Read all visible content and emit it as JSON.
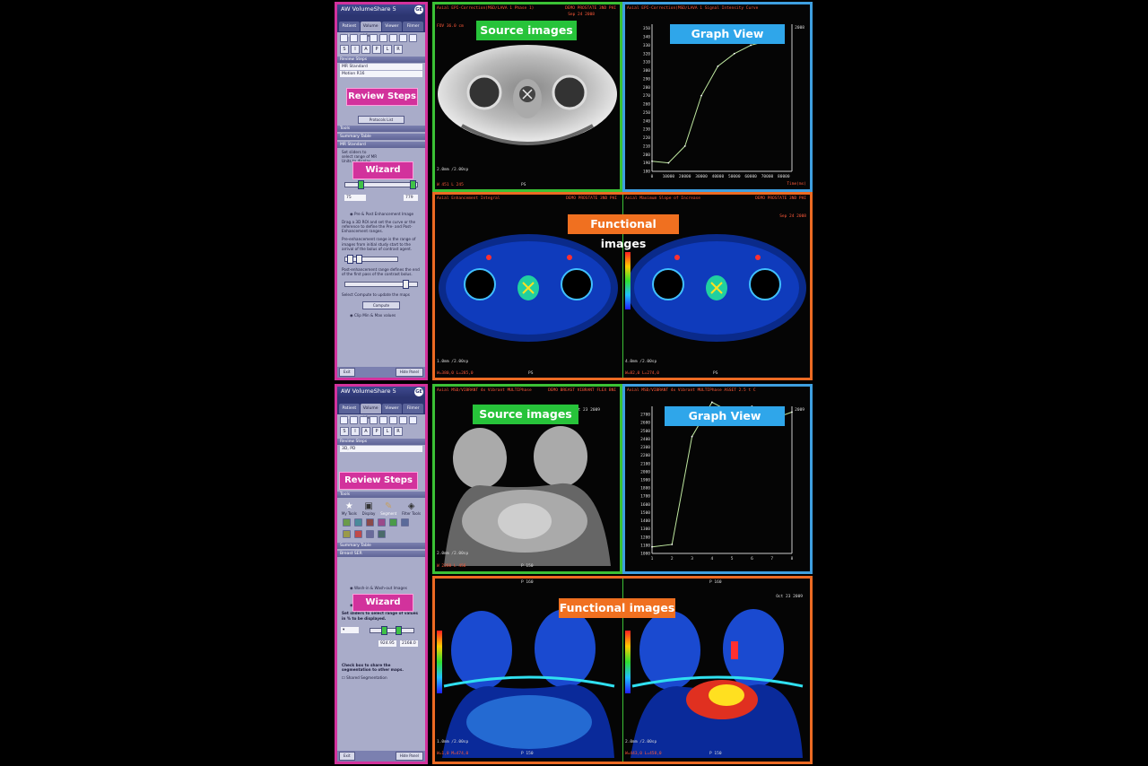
{
  "top": {
    "sidebar": {
      "app_title": "AW VolumeShare 5",
      "tabs": [
        "Patient List",
        "Volume Viewer",
        "Viewer",
        "Filmer"
      ],
      "letters": [
        "S",
        "I",
        "A",
        "P",
        "L",
        "R"
      ],
      "review_steps_bar": "Review Steps",
      "field1": "MR Standard",
      "field2": "Motion R16",
      "review_steps_tag": "Review Steps",
      "protocols_list": "Protocols List",
      "tools_bar": "Tools",
      "summary_table_bar": "Summary Table",
      "mr_standard_bar": "MR Standard",
      "wizard_tag": "Wizard",
      "set_sliders_text": "Set sliders to select range of MR Units to display",
      "min_value": "75",
      "max_value": "779",
      "pre_post_option": "Pre & Post Enhancement Image",
      "instruction1": "Drag a 3D ROI and set the curve or the reference to define the Pre- and Post-Enhancement ranges.",
      "instruction2": "Pre-enhancement range is the range of images from initial study start to the arrival of the bolus of contrast agent.",
      "instruction3": "Post-enhancement range defines the end of the first pass of the contrast bolus.",
      "compute_hint": "Select Compute to update the maps",
      "compute_button": "Compute",
      "clip_option": "Clip Min & Max values",
      "exit_button": "Exit",
      "hide_panel_button": "Hide Panel"
    },
    "source_label": "Source images",
    "graph_label": "Graph View",
    "functional_label": "Functional images",
    "source_overlay": {
      "header": "Axial EPI-Correction(MSD/LAVA 1 Phase 1)",
      "patient": "DEMO PROSTATE 3ND PHI",
      "date": "Sep 24 2008",
      "fov": "FOV 36.0 cm",
      "bottom": "2.0mm /2.00sp",
      "wl": "W 451 L 245",
      "ps": "PS"
    },
    "graph_overlay": {
      "header": "Axial EPI-Correction(MSD/LAVA 1 Signal Intensity Curve",
      "date": "2008",
      "xlabel": "Time(ms)",
      "y_ticks": [
        "350",
        "340",
        "330",
        "320",
        "310",
        "300",
        "290",
        "280",
        "270",
        "260",
        "250",
        "240",
        "230",
        "220",
        "210",
        "200",
        "190",
        "180"
      ],
      "x_ticks": [
        "0",
        "10000",
        "20000",
        "30000",
        "40000",
        "50000",
        "60000",
        "70000",
        "80000"
      ]
    },
    "func_left_overlay": {
      "header": "Axial Enhancement Integral",
      "patient": "DEMO PROSTATE 3ND PHI",
      "bottom": "1.0mm /2.00sp",
      "wl": "W=380,0 L=285,0",
      "ps": "PS"
    },
    "func_right_overlay": {
      "header": "Axial Maximum Slope of Increase",
      "patient": "DEMO PROSTATE 3ND PHI",
      "date": "Sep 24 2008",
      "bottom": "4.0mm /2.00sp",
      "wl": "W=82,0 L=274,0",
      "ps": "PS"
    },
    "chart_data": {
      "type": "line",
      "x": [
        0,
        10000,
        20000,
        30000,
        40000,
        50000,
        60000,
        70000,
        80000
      ],
      "y": [
        192,
        190,
        210,
        270,
        305,
        320,
        330,
        335,
        338
      ],
      "xlabel": "Time(ms)",
      "ylim": [
        180,
        355
      ]
    }
  },
  "bottom": {
    "sidebar": {
      "app_title": "AW VolumeShare 5",
      "tabs": [
        "Patient List",
        "Volume Viewer",
        "Viewer",
        "Filmer"
      ],
      "letters": [
        "S",
        "I",
        "A",
        "P",
        "L",
        "R"
      ],
      "review_steps_bar": "Review Steps",
      "field1": "3D, PD",
      "review_steps_tag": "Review Steps",
      "protocols_list": "Protocols List",
      "tools_bar": "Tools",
      "tools_labels": [
        "My Tools",
        "Display",
        "Segment",
        "Filter Tools"
      ],
      "summary_table_bar": "Summary Table",
      "breast_ser_bar": "Breast SER",
      "wizard_tag": "Wizard",
      "wash_option": "Wash-in & Wash-out Images",
      "clip_option": "Clip Min & Max values",
      "set_sliders_text": "Set sliders to select range of values in % to be displayed.",
      "min_value": "924.95",
      "max_value": "2168.0",
      "share_text": "Check box to share the segmentation to other maps.",
      "shared_seg": "Shared Segmentation",
      "exit_button": "Exit",
      "hide_panel_button": "Hide Panel"
    },
    "source_label": "Source images",
    "graph_label": "Graph View",
    "functional_label": "Functional images",
    "source_overlay": {
      "header": "Axial MSD/VIBRANT 4x Vibrant MULTIPhase",
      "patient": "DEMO BREAST VIBRANT FLEX BNI",
      "date": "Oct 23 2009",
      "bottom": "2.0mm /2.00sp",
      "wl": "W 2260 L 456",
      "ps": "P 150"
    },
    "graph_overlay": {
      "header": "Axial MSD/VIBRANT 4x Vibrant MULTIPhase ASSET 2.5 t C",
      "date": "2009",
      "y_ticks": [
        "2700",
        "2600",
        "2500",
        "2400",
        "2300",
        "2200",
        "2100",
        "2000",
        "1900",
        "1800",
        "1700",
        "1600",
        "1500",
        "1400",
        "1300",
        "1200",
        "1100",
        "1000"
      ],
      "x_ticks": [
        "1",
        "2",
        "3",
        "4",
        "5",
        "6",
        "7",
        "8"
      ]
    },
    "func_left_overlay": {
      "top": "P 160",
      "bottom": "1.0mm /2.00sp",
      "wl": "W=1,0 M=474,0",
      "ps": "P 150"
    },
    "func_right_overlay": {
      "top": "P 160",
      "date": "Oct 23 2009",
      "bottom": "2.0mm /2.00sp",
      "wl": "W=443,0 L=458,0",
      "ps": "P 150"
    },
    "chart_data": {
      "type": "line",
      "x": [
        1,
        2,
        3,
        4,
        5,
        6,
        7,
        8
      ],
      "y": [
        1080,
        1110,
        2430,
        2850,
        2720,
        2800,
        2640,
        2730
      ],
      "ylim": [
        1000,
        2800
      ]
    }
  }
}
